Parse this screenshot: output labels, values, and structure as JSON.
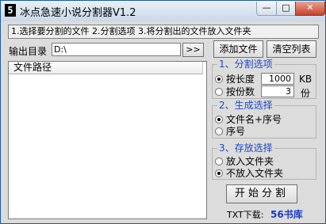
{
  "window": {
    "title": "冰点急速小说分割器V1.2",
    "icon_glyph": "5"
  },
  "titlebar_buttons": {
    "minimize": "—",
    "maximize": "□",
    "close": "✕"
  },
  "steps_text": "1.选择要分割的文件 2.分割选项 3.将分割出的文件放入文件夹",
  "output": {
    "label": "输出目录",
    "value": "D:\\",
    "browse_label": ">>"
  },
  "buttons": {
    "add_file": "添加文件",
    "clear_list": "清空列表",
    "start_split": "开始分割"
  },
  "file_list": {
    "columns": [
      "文件路径"
    ]
  },
  "split_options": {
    "title": "1、分割选项",
    "by_length": {
      "label": "按长度",
      "value": "1000",
      "unit": "KB",
      "selected": true
    },
    "by_parts": {
      "label": "按份数",
      "value": "3",
      "unit": "份",
      "selected": false
    }
  },
  "generate_options": {
    "title": "2、生成选择",
    "items": [
      {
        "label": "文件名+序号",
        "selected": true
      },
      {
        "label": "序号",
        "selected": false
      }
    ]
  },
  "storage_options": {
    "title": "3、存放选择",
    "items": [
      {
        "label": "放入文件夹",
        "selected": false
      },
      {
        "label": "不放入文件夹",
        "selected": true
      }
    ]
  },
  "footer": {
    "download_label": "TXT下载:",
    "link_text": "56书库"
  }
}
